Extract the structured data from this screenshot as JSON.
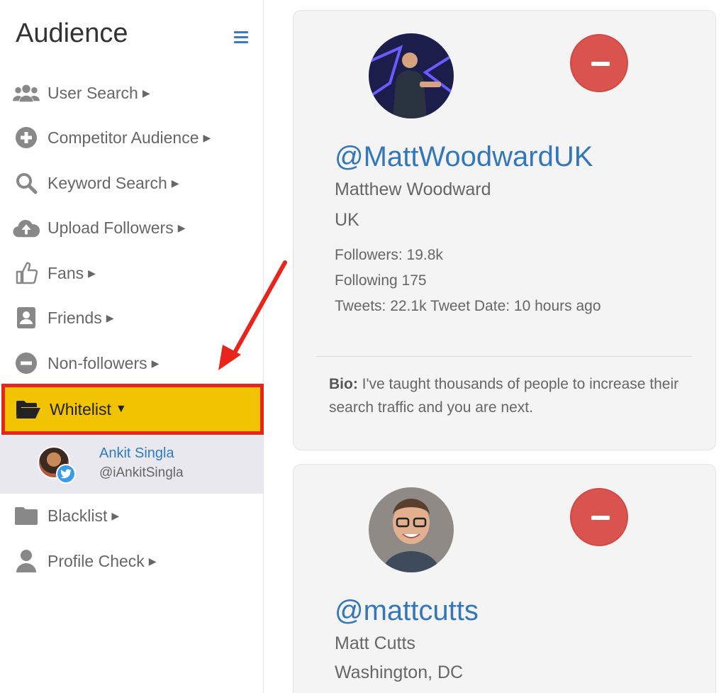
{
  "sidebar": {
    "title": "Audience",
    "menu_icon": "hamburger-icon",
    "items": [
      {
        "label": "User Search",
        "icon": "users-icon"
      },
      {
        "label": "Competitor Audience",
        "icon": "plus-circle-icon"
      },
      {
        "label": "Keyword Search",
        "icon": "search-icon"
      },
      {
        "label": "Upload Followers",
        "icon": "cloud-upload-icon"
      },
      {
        "label": "Fans",
        "icon": "thumbs-up-icon"
      },
      {
        "label": "Friends",
        "icon": "contact-card-icon"
      },
      {
        "label": "Non-followers",
        "icon": "minus-circle-icon"
      },
      {
        "label": "Whitelist",
        "icon": "folder-open-icon",
        "active": true
      },
      {
        "label": "Blacklist",
        "icon": "folder-icon"
      },
      {
        "label": "Profile Check",
        "icon": "user-icon"
      }
    ],
    "account": {
      "name": "Ankit Singla",
      "handle": "@iAnkitSingla"
    }
  },
  "cards": [
    {
      "handle": "@MattWoodwardUK",
      "name": "Matthew Woodward",
      "location": "UK",
      "followers": "Followers: 19.8k",
      "following": "Following 175",
      "tweets": "Tweets: 22.1k Tweet Date: 10 hours ago",
      "bio_label": "Bio:",
      "bio": "I've taught thousands of people to increase their search traffic and you are next."
    },
    {
      "handle": "@mattcutts",
      "name": "Matt Cutts",
      "location": "Washington, DC"
    }
  ],
  "colors": {
    "accent_link": "#3377b9",
    "active_highlight": "#f2c300",
    "annotation_red": "#e8241b",
    "remove_button": "#d9534f"
  }
}
